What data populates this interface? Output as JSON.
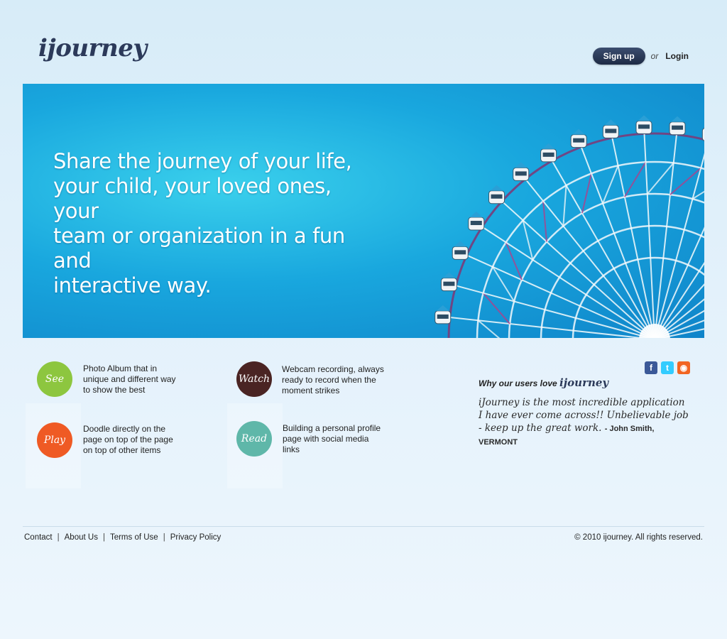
{
  "header": {
    "logo": "ijourney",
    "signup_label": "Sign up",
    "or_text": "or",
    "login_label": "Login"
  },
  "hero": {
    "tagline_lines": [
      "Share the journey of your life,",
      "your child, your loved ones, your",
      "team or organization in a fun and",
      "interactive way."
    ]
  },
  "features": [
    {
      "label": "See",
      "color": "#8dc63f",
      "lines": [
        "Photo Album that in",
        "unique and different way",
        "to show the best"
      ]
    },
    {
      "label": "Watch",
      "color": "#4a2423",
      "lines": [
        "Webcam recording, always",
        "ready to record when the",
        "moment strikes"
      ]
    },
    {
      "label": "Play",
      "color": "#ef5a24",
      "lines": [
        "Doodle directly on the",
        "page on top of the page",
        "on top of other items"
      ]
    },
    {
      "label": "Read",
      "color": "#5fb7a9",
      "lines": [
        "Building a personal profile",
        "page with social media",
        "links"
      ]
    }
  ],
  "testimonial": {
    "heading": "Why our users love",
    "brand": "ijourney",
    "quote": "iJourney is the most incredible application I have ever come across!! Unbelievable job - keep up the great work.",
    "author": "- John Smith, VERMONT"
  },
  "social": [
    {
      "icon": "facebook-icon",
      "glyph": "f",
      "color": "#3b5998"
    },
    {
      "icon": "twitter-icon",
      "glyph": "t",
      "color": "#33ccff"
    },
    {
      "icon": "rss-icon",
      "glyph": "◉",
      "color": "#f26522"
    }
  ],
  "footer": {
    "links": [
      "Contact",
      "About Us",
      "Terms of Use",
      "Privacy Policy"
    ],
    "copyright": "© 2010 ijourney. All rights reserved."
  }
}
